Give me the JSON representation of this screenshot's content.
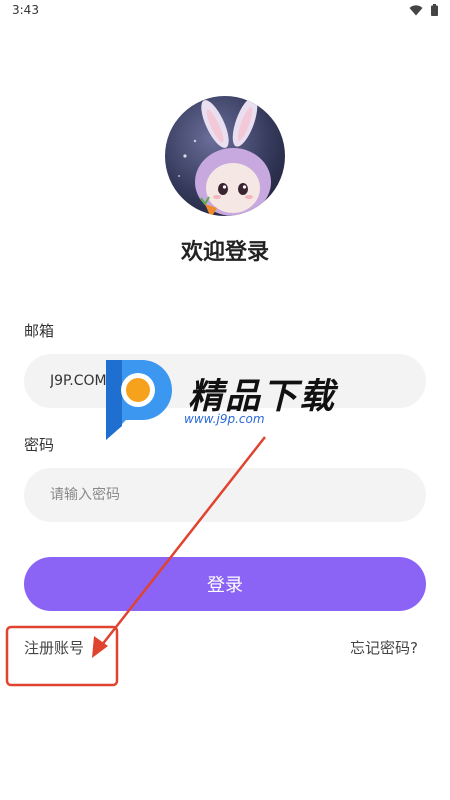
{
  "status": {
    "time": "3:43",
    "wifi_icon": "wifi-icon",
    "battery_icon": "battery-icon"
  },
  "avatar_icon": "bunny-avatar-icon",
  "title": "欢迎登录",
  "email": {
    "label": "邮箱",
    "value": "J9P.COM"
  },
  "password": {
    "label": "密码",
    "placeholder": "请输入密码"
  },
  "login_button": "登录",
  "register_link": "注册账号",
  "forgot_link": "忘记密码?",
  "watermark": {
    "brand": "精品下载",
    "url": "www.j9p.com"
  },
  "colors": {
    "accent": "#8b63f5",
    "annotation": "#e0432f"
  }
}
